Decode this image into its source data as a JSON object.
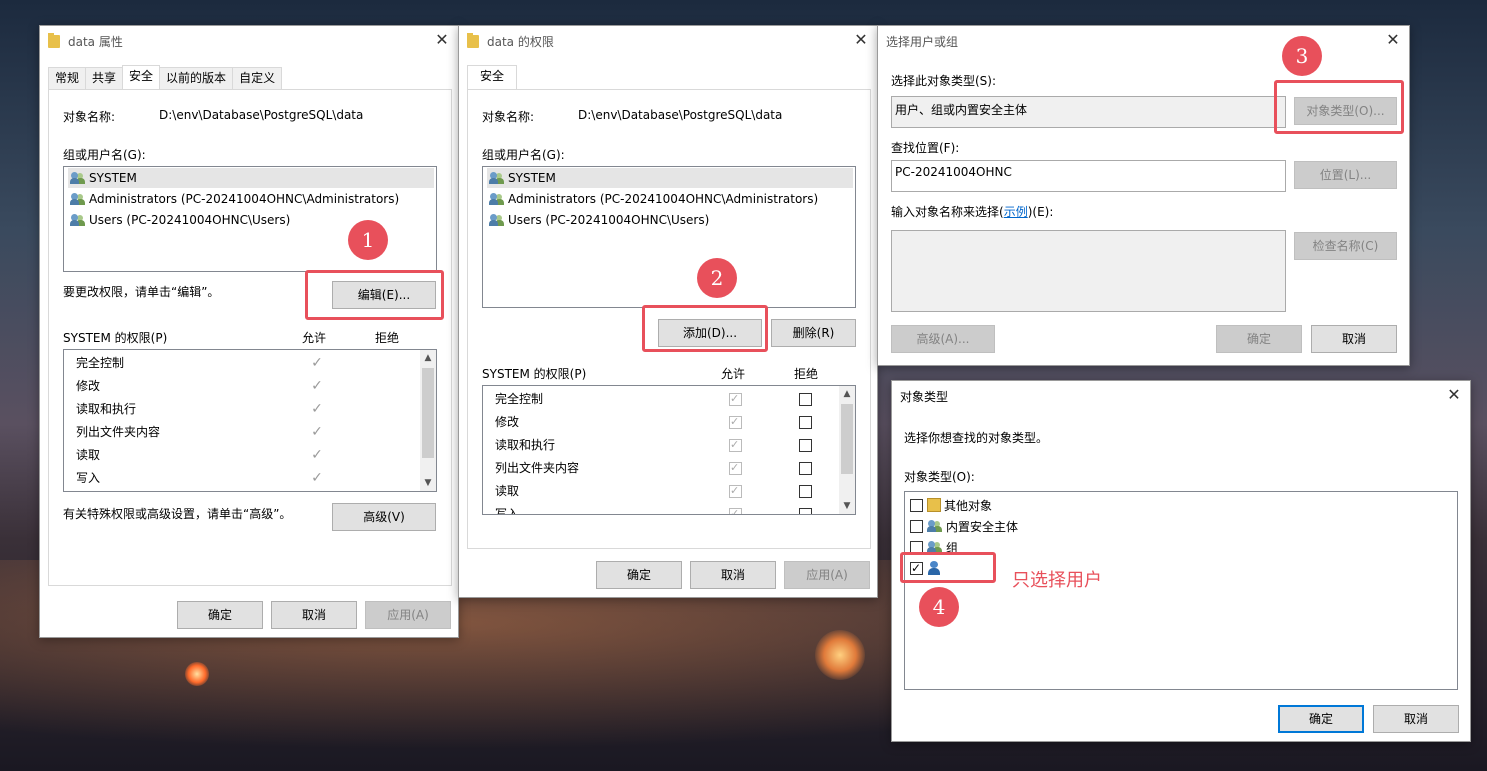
{
  "dlg1": {
    "title": "data 属性",
    "tabs": [
      {
        "label": "常规"
      },
      {
        "label": "共享"
      },
      {
        "label": "安全"
      },
      {
        "label": "以前的版本"
      },
      {
        "label": "自定义"
      }
    ],
    "object_name_label": "对象名称:",
    "object_name_value": "D:\\env\\Database\\PostgreSQL\\data",
    "group_label": "组或用户名(G):",
    "users": [
      {
        "name": "SYSTEM"
      },
      {
        "name": "Administrators (PC-20241004OHNC\\Administrators)"
      },
      {
        "name": "Users (PC-20241004OHNC\\Users)"
      }
    ],
    "edit_hint": "要更改权限，请单击“编辑”。",
    "edit_button": "编辑(E)...",
    "perm_title": "SYSTEM 的权限(P)",
    "allow_label": "允许",
    "deny_label": "拒绝",
    "permissions": [
      {
        "name": "完全控制"
      },
      {
        "name": "修改"
      },
      {
        "name": "读取和执行"
      },
      {
        "name": "列出文件夹内容"
      },
      {
        "name": "读取"
      },
      {
        "name": "写入"
      }
    ],
    "advanced_hint": "有关特殊权限或高级设置，请单击“高级”。",
    "advanced_button": "高级(V)",
    "ok": "确定",
    "cancel": "取消",
    "apply": "应用(A)"
  },
  "dlg2": {
    "title": "data 的权限",
    "tab": "安全",
    "object_name_label": "对象名称:",
    "object_name_value": "D:\\env\\Database\\PostgreSQL\\data",
    "group_label": "组或用户名(G):",
    "users": [
      {
        "name": "SYSTEM"
      },
      {
        "name": "Administrators (PC-20241004OHNC\\Administrators)"
      },
      {
        "name": "Users (PC-20241004OHNC\\Users)"
      }
    ],
    "add_button": "添加(D)...",
    "remove_button": "删除(R)",
    "perm_title": "SYSTEM 的权限(P)",
    "allow_label": "允许",
    "deny_label": "拒绝",
    "permissions": [
      {
        "name": "完全控制"
      },
      {
        "name": "修改"
      },
      {
        "name": "读取和执行"
      },
      {
        "name": "列出文件夹内容"
      },
      {
        "name": "读取"
      },
      {
        "name": "写入"
      }
    ],
    "ok": "确定",
    "cancel": "取消",
    "apply": "应用(A)"
  },
  "dlg3": {
    "title": "选择用户或组",
    "type_label": "选择此对象类型(S):",
    "type_value": "用户、组或内置安全主体",
    "type_button": "对象类型(O)...",
    "location_label": "查找位置(F):",
    "location_value": "PC-20241004OHNC",
    "location_button": "位置(L)...",
    "names_label_pre": "输入对象名称来选择(",
    "names_label_link": "示例",
    "names_label_post": ")(E):",
    "check_button": "检查名称(C)",
    "advanced_button": "高级(A)...",
    "ok": "确定",
    "cancel": "取消"
  },
  "dlg4": {
    "title": "对象类型",
    "desc": "选择你想查找的对象类型。",
    "types_label": "对象类型(O):",
    "types": [
      {
        "label": "其他对象",
        "checked": false,
        "icon": "folder-icon"
      },
      {
        "label": "内置安全主体",
        "checked": false,
        "icon": "users-icon"
      },
      {
        "label": "组",
        "checked": false,
        "icon": "users-icon"
      },
      {
        "label": "",
        "checked": true,
        "icon": "user-icon"
      }
    ],
    "ok": "确定",
    "cancel": "取消"
  },
  "annotations": {
    "n1": "1",
    "n2": "2",
    "n3": "3",
    "n4": "4",
    "note": "只选择用户",
    "color": "#e8505b"
  }
}
